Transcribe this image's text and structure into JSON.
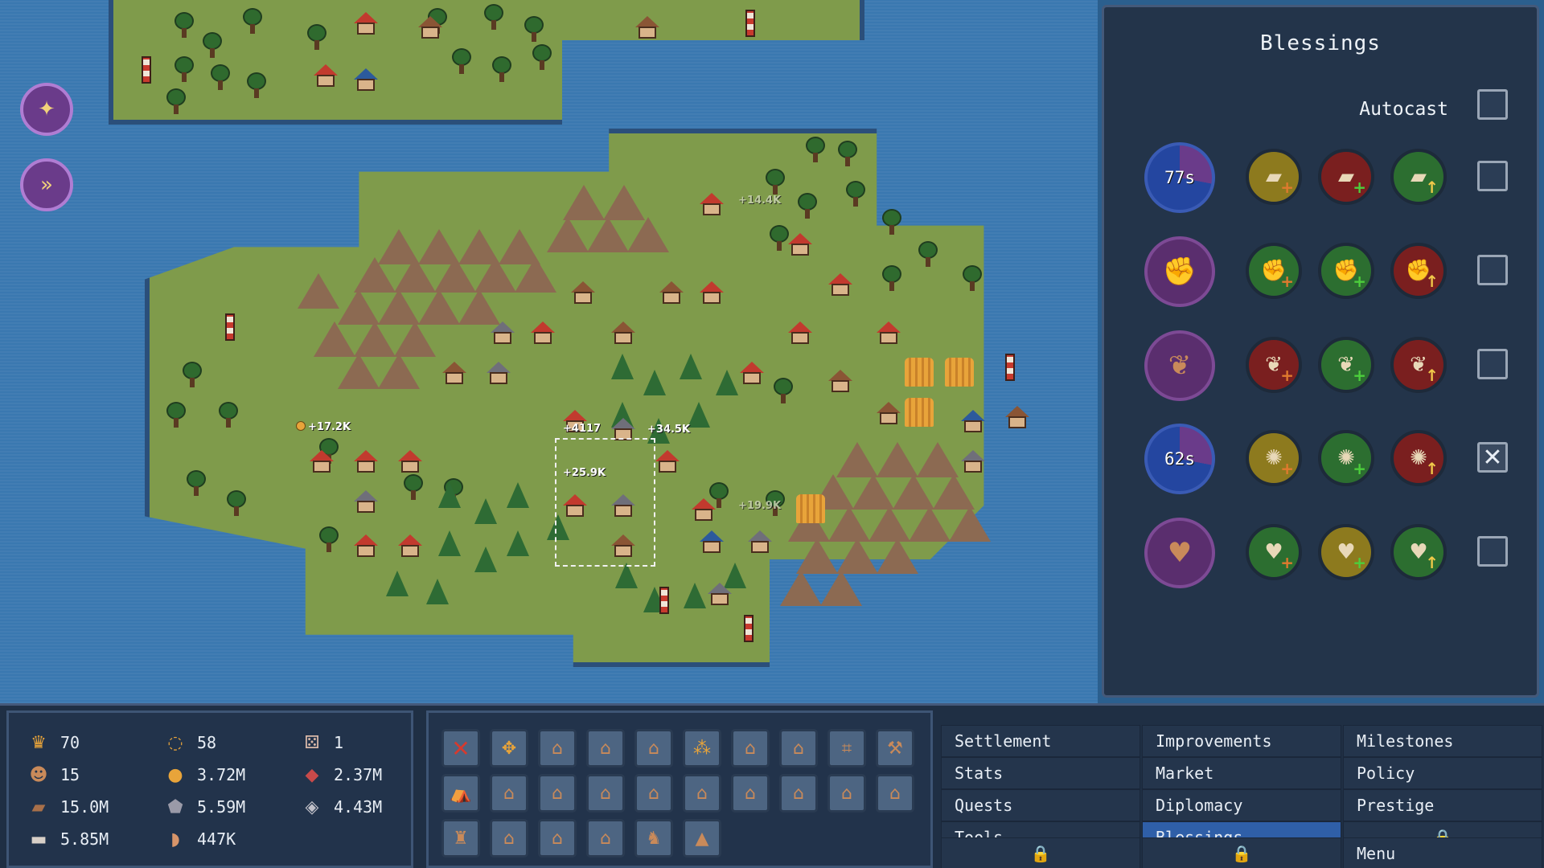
{
  "map": {
    "floating_labels": [
      "+17.2K",
      "+4117",
      "+34.5K",
      "+25.9K",
      "+19.9K",
      "+14.4K"
    ],
    "left_buttons": [
      {
        "name": "blessing-cast-icon",
        "glyph": "✦"
      },
      {
        "name": "speed-icon",
        "glyph": "»"
      }
    ]
  },
  "blessings": {
    "title": "Blessings",
    "autocast_label": "Autocast",
    "rows": [
      {
        "main_icon": "wood-icon",
        "main_glyph": "▰",
        "cooldown": "77s",
        "checked": false,
        "options": [
          {
            "color": "gold",
            "glyph": "▰",
            "badge": "+",
            "badge_color": "#e07a2e"
          },
          {
            "color": "red",
            "glyph": "▰",
            "badge": "+",
            "badge_color": "#4ccf3c"
          },
          {
            "color": "green",
            "glyph": "▰",
            "badge": "↑",
            "badge_color": "#f0c94a"
          }
        ]
      },
      {
        "main_icon": "strength-icon",
        "main_glyph": "✊",
        "cooldown": "",
        "checked": false,
        "options": [
          {
            "color": "green",
            "glyph": "✊",
            "badge": "+",
            "badge_color": "#e07a2e"
          },
          {
            "color": "green",
            "glyph": "✊",
            "badge": "+",
            "badge_color": "#4ccf3c"
          },
          {
            "color": "red",
            "glyph": "✊",
            "badge": "↑",
            "badge_color": "#f0c94a"
          }
        ]
      },
      {
        "main_icon": "seed-icon",
        "main_glyph": "❦",
        "cooldown": "",
        "checked": false,
        "options": [
          {
            "color": "red",
            "glyph": "❦",
            "badge": "+",
            "badge_color": "#e07a2e"
          },
          {
            "color": "green",
            "glyph": "❦",
            "badge": "+",
            "badge_color": "#4ccf3c"
          },
          {
            "color": "red",
            "glyph": "❦",
            "badge": "↑",
            "badge_color": "#f0c94a"
          }
        ]
      },
      {
        "main_icon": "happiness-icon",
        "main_glyph": "✺",
        "cooldown": "62s",
        "checked": true,
        "options": [
          {
            "color": "gold",
            "glyph": "✺",
            "badge": "+",
            "badge_color": "#e07a2e"
          },
          {
            "color": "green",
            "glyph": "✺",
            "badge": "+",
            "badge_color": "#4ccf3c"
          },
          {
            "color": "red",
            "glyph": "✺",
            "badge": "↑",
            "badge_color": "#f0c94a"
          }
        ]
      },
      {
        "main_icon": "heart-icon",
        "main_glyph": "♥",
        "cooldown": "",
        "checked": false,
        "options": [
          {
            "color": "green",
            "glyph": "♥",
            "badge": "+",
            "badge_color": "#e07a2e"
          },
          {
            "color": "gold",
            "glyph": "♥",
            "badge": "+",
            "badge_color": "#4ccf3c"
          },
          {
            "color": "green",
            "glyph": "♥",
            "badge": "↑",
            "badge_color": "#f0c94a"
          }
        ]
      }
    ]
  },
  "resources": [
    {
      "icon": "crown-icon",
      "glyph": "♛",
      "color": "#e8a43a",
      "value": "70"
    },
    {
      "icon": "cycle-icon",
      "glyph": "◌",
      "color": "#e8a43a",
      "value": "58"
    },
    {
      "icon": "dice-icon",
      "glyph": "⚄",
      "color": "#d8b8a8",
      "value": "1"
    },
    {
      "icon": "population-icon",
      "glyph": "☻",
      "color": "#c98a5a",
      "value": "15"
    },
    {
      "icon": "gold-icon",
      "glyph": "●",
      "color": "#e8a43a",
      "value": "3.72M"
    },
    {
      "icon": "meat-icon",
      "glyph": "◆",
      "color": "#c84a4a",
      "value": "2.37M"
    },
    {
      "icon": "wood-icon",
      "glyph": "▰",
      "color": "#a8704a",
      "value": "15.0M"
    },
    {
      "icon": "stone-icon",
      "glyph": "⬟",
      "color": "#9a9aa8",
      "value": "5.59M"
    },
    {
      "icon": "iron-icon",
      "glyph": "◈",
      "color": "#c0c0c8",
      "value": "4.43M"
    },
    {
      "icon": "plank-icon",
      "glyph": "▬",
      "color": "#d8d0c8",
      "value": "5.85M"
    },
    {
      "icon": "bread-icon",
      "glyph": "◗",
      "color": "#d8956a",
      "value": "447K"
    }
  ],
  "build_tools": [
    {
      "name": "demolish-tool-icon",
      "glyph": "✕",
      "style": "red"
    },
    {
      "name": "move-tool-icon",
      "glyph": "✥",
      "style": "orange"
    },
    {
      "name": "hut-icon",
      "glyph": "⌂",
      "style": ""
    },
    {
      "name": "house-icon",
      "glyph": "⌂",
      "style": ""
    },
    {
      "name": "manor-icon",
      "glyph": "⌂",
      "style": ""
    },
    {
      "name": "farm-icon",
      "glyph": "⁂",
      "style": "orange"
    },
    {
      "name": "lumber-mill-icon",
      "glyph": "⌂",
      "style": ""
    },
    {
      "name": "quarry-icon",
      "glyph": "⌂",
      "style": ""
    },
    {
      "name": "mine-icon",
      "glyph": "⌗",
      "style": ""
    },
    {
      "name": "workshop-icon",
      "glyph": "⚒",
      "style": ""
    },
    {
      "name": "tent-icon",
      "glyph": "⛺",
      "style": ""
    },
    {
      "name": "hunter-icon",
      "glyph": "⌂",
      "style": ""
    },
    {
      "name": "smithy-icon",
      "glyph": "⌂",
      "style": ""
    },
    {
      "name": "bakery-icon",
      "glyph": "⌂",
      "style": ""
    },
    {
      "name": "storehouse-icon",
      "glyph": "⌂",
      "style": ""
    },
    {
      "name": "barracks-icon",
      "glyph": "⌂",
      "style": ""
    },
    {
      "name": "barn-icon",
      "glyph": "⌂",
      "style": ""
    },
    {
      "name": "stable-icon",
      "glyph": "⌂",
      "style": ""
    },
    {
      "name": "granary-icon",
      "glyph": "⌂",
      "style": ""
    },
    {
      "name": "market-stall-icon",
      "glyph": "⌂",
      "style": ""
    },
    {
      "name": "lighthouse-icon",
      "glyph": "♜",
      "style": ""
    },
    {
      "name": "chapel-icon",
      "glyph": "⌂",
      "style": ""
    },
    {
      "name": "well-icon",
      "glyph": "⌂",
      "style": ""
    },
    {
      "name": "bank-icon",
      "glyph": "⌂",
      "style": ""
    },
    {
      "name": "statue-icon",
      "glyph": "♞",
      "style": ""
    },
    {
      "name": "monument-icon",
      "glyph": "▲",
      "style": ""
    }
  ],
  "menu": {
    "col1": [
      "Settlement",
      "Stats",
      "Quests",
      "Tools"
    ],
    "col2": [
      "Improvements",
      "Market",
      "Diplomacy",
      "Blessings"
    ],
    "col3": [
      "Milestones",
      "Policy",
      "Prestige"
    ],
    "menu_label": "Menu",
    "lock_glyph": "🔒",
    "active": "Blessings"
  }
}
